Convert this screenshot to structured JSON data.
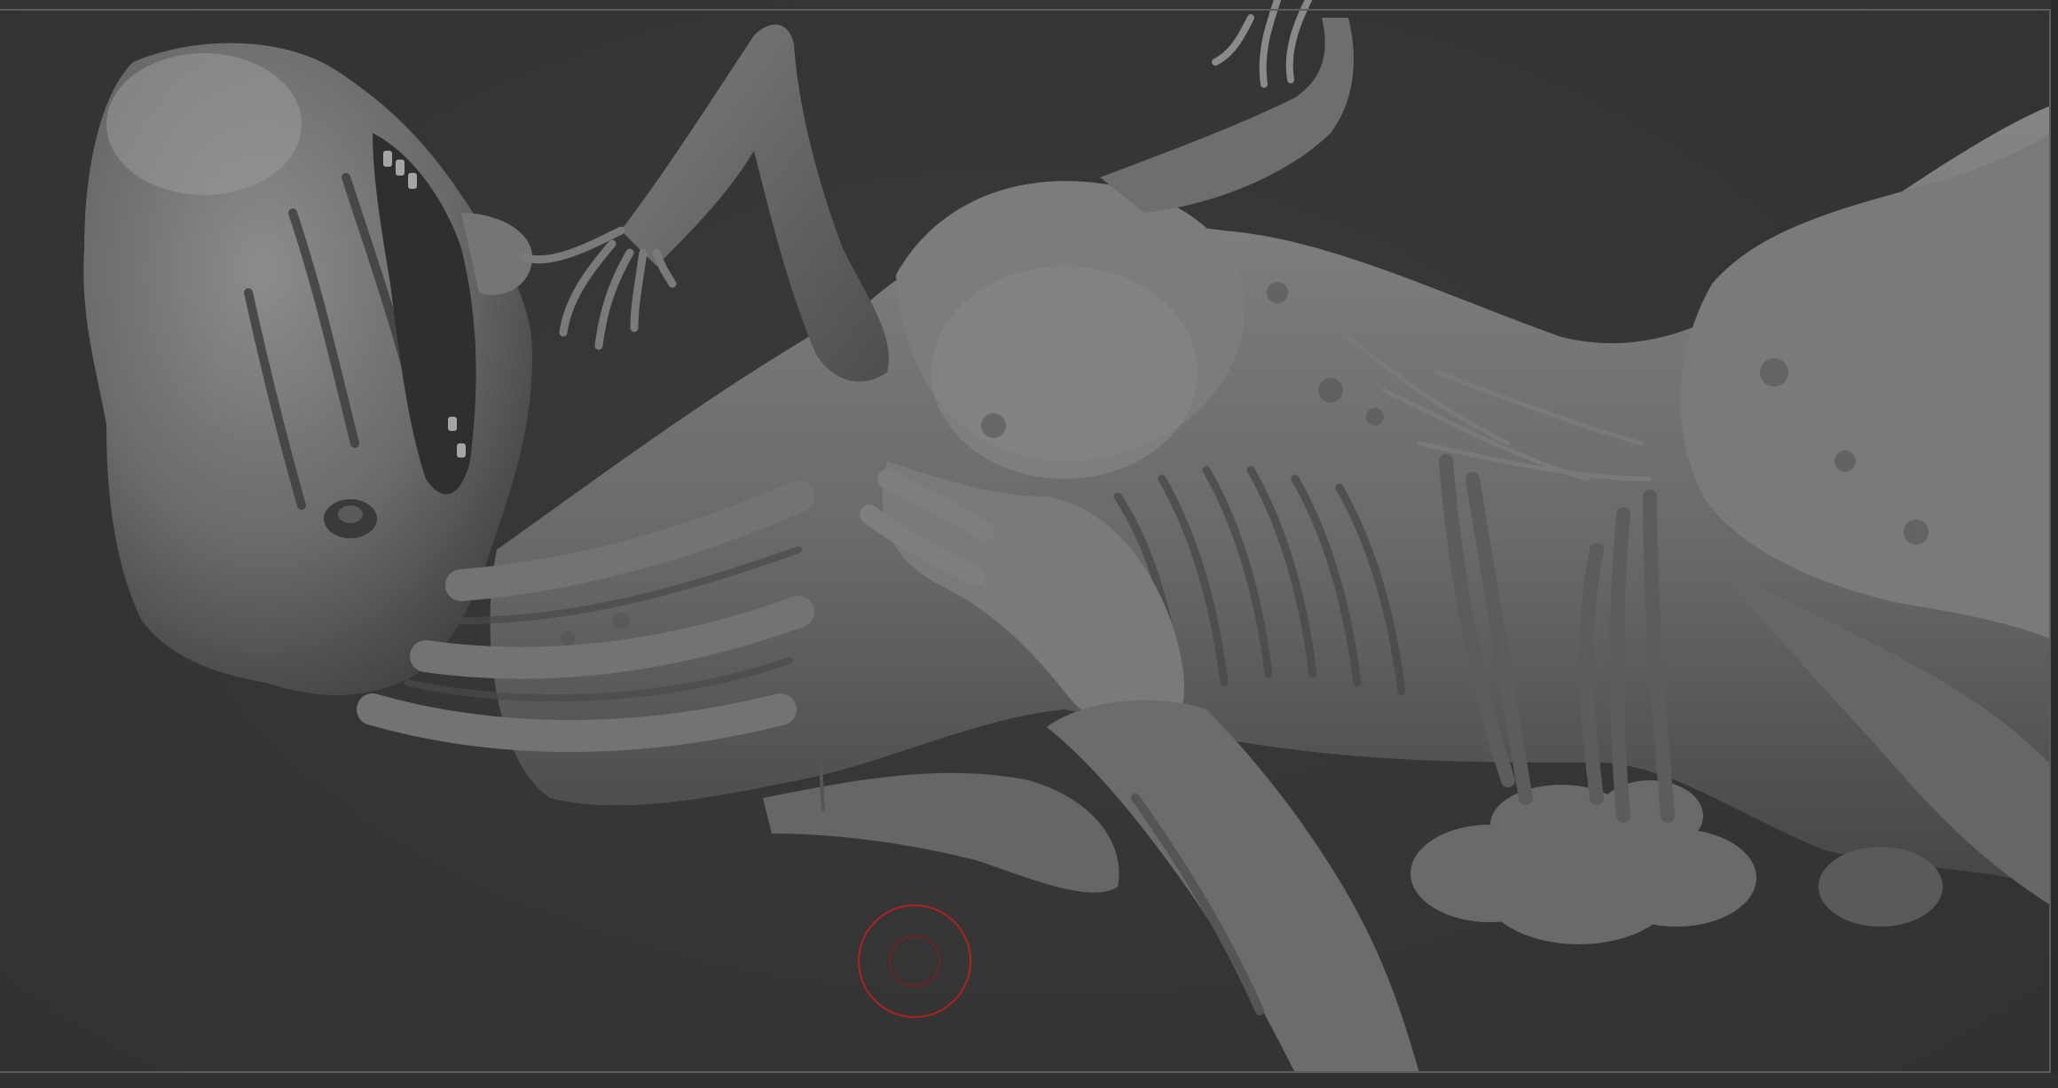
{
  "viewport": {
    "background_color": "#343434",
    "frame_color": "#5b5b5b",
    "mesh_color": "#6e6e6e",
    "mesh_shadow_color": "#3d3d3d",
    "mesh_highlight_color": "#9a9a9a"
  },
  "brush_cursor": {
    "icon": "brush-circle-icon",
    "color": "#b02222"
  }
}
